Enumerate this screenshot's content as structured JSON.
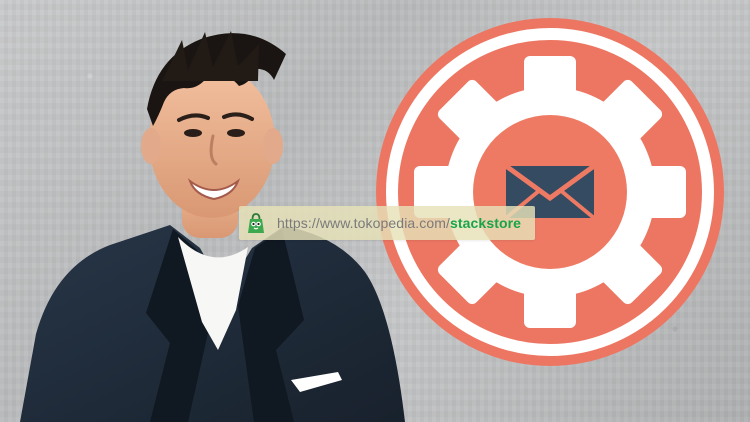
{
  "watermark": {
    "url_prefix": "https://www.tokopedia.com/",
    "url_suffix": "stackstore",
    "icon": "shopping-bag-icon"
  },
  "logo": {
    "outer_circle_color": "#ed7662",
    "ring_color": "#ffffff",
    "gear_color": "#ffffff",
    "inner_circle_color": "#ef7a64",
    "envelope_color": "#344b62",
    "icon": "envelope-icon"
  },
  "portrait": {
    "jacket_color": "#1f2b3a",
    "shirt_color": "#f7f7f5",
    "pocket_square_color": "#ffffff",
    "hair_color": "#1a1512",
    "skin_color": "#e8b591"
  }
}
